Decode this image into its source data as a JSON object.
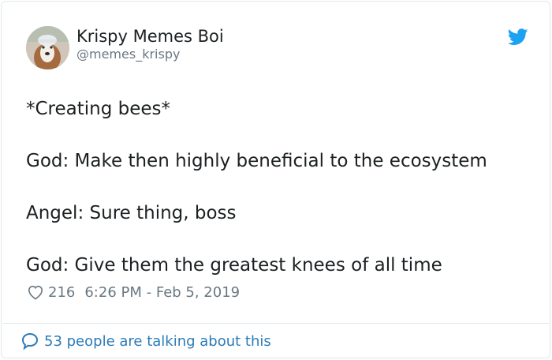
{
  "author": {
    "display_name": "Krispy Memes Boi",
    "handle": "@memes_krispy"
  },
  "tweet": {
    "lines": [
      "*Creating bees*",
      "God: Make then highly beneficial to the ecosystem",
      "Angel: Sure thing, boss",
      "God: Give them the greatest knees of all time"
    ]
  },
  "meta": {
    "like_count": "216",
    "timestamp": "6:26 PM - Feb 5, 2019"
  },
  "footer": {
    "talking_text": "53 people are talking about this"
  },
  "icons": {
    "brand": "twitter-bird-icon",
    "like": "heart-icon",
    "reply": "speech-bubble-icon"
  },
  "colors": {
    "brand_blue": "#1da1f2",
    "link_blue": "#2b7bb9",
    "meta_gray": "#697882",
    "text": "#1c2022",
    "border": "#e1e8ed"
  }
}
